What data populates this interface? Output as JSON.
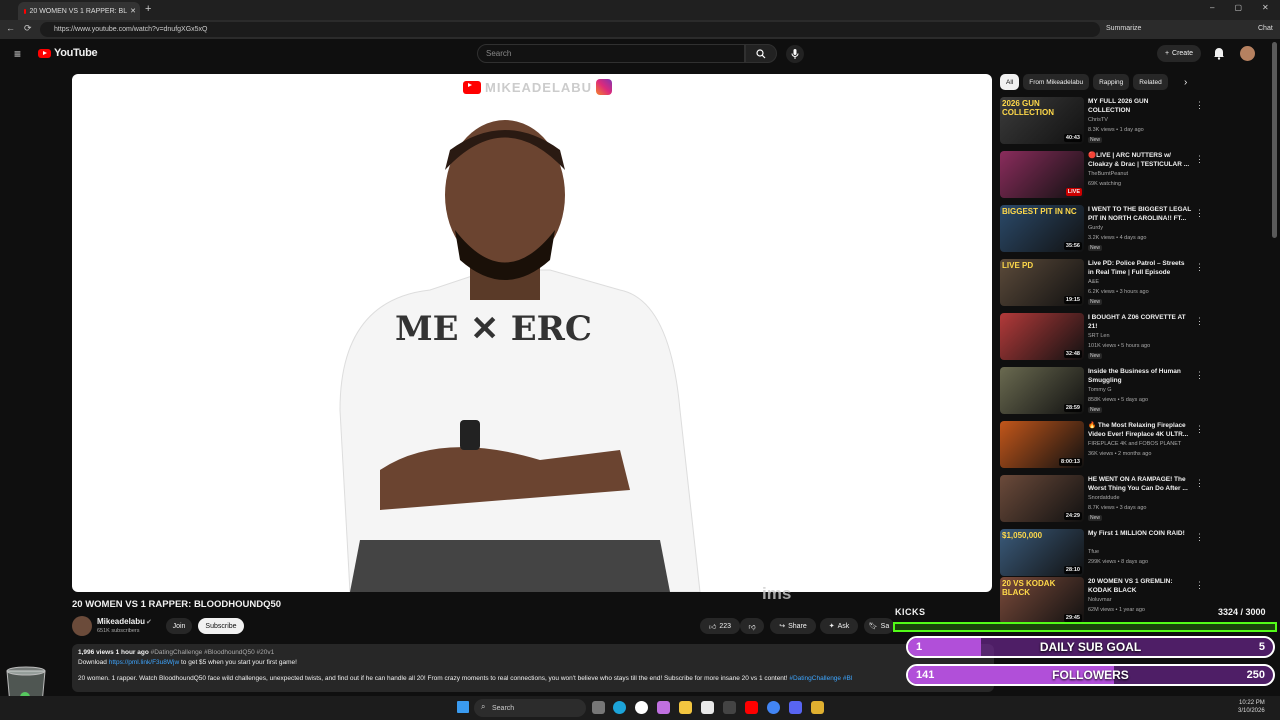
{
  "browser": {
    "tab_title": "20 WOMEN VS 1 RAPPER: BL",
    "url": "https://www.youtube.com/watch?v=dnufgXGx5xQ",
    "summarize_label": "Summarize",
    "chat_label": "Chat"
  },
  "header": {
    "logo_text": "YouTube",
    "search_placeholder": "Search",
    "create_label": "Create"
  },
  "video": {
    "channel_watermark": "MIKEADELABU",
    "caption_text": "ims",
    "title": "20 WOMEN VS 1 RAPPER: BLOODHOUNDQ50",
    "channel_name": "Mikeadelabu",
    "channel_subs": "651K subscribers",
    "join_label": "Join",
    "subscribe_label": "Subscribe",
    "like_count": "223",
    "share_label": "Share",
    "ask_label": "Ask",
    "save_label": "Sa"
  },
  "description": {
    "meta": "1,996 views  1 hour ago",
    "hashtags": "#DatingChallenge #BloodhoundQ50 #20v1",
    "download_prefix": "Download",
    "download_link": "https://pml.link/F3u8Wjw",
    "download_suffix": "to get $5 when you start your first game!",
    "body": "20 women. 1 rapper. Watch BloodhoundQ50 face wild challenges, unexpected twists, and find out if he can handle all 20! From crazy moments to real connections, you won't believe who stays till the end! Subscribe for more insane 20 vs 1 content!",
    "body_tags": "#DatingChallenge #Bl"
  },
  "chips": [
    "All",
    "From Mikeadelabu",
    "Rapping",
    "Related"
  ],
  "recommendations": [
    {
      "title": "MY FULL 2026 GUN COLLECTION",
      "channel": "ChrisTV",
      "meta": "8.3K views • 1 day ago",
      "badge": "New",
      "duration": "40:43",
      "thumb_text": "2026 GUN COLLECTION",
      "color": "#3b3b3b"
    },
    {
      "title": "🔴LIVE | ARC NUTTERS w/ Cloakzy & Drac | TESTICULAR ...",
      "channel": "TheBurntPeanut",
      "meta": "69K watching",
      "badge": "",
      "duration": "LIVE",
      "thumb_text": "",
      "color": "#8a2c5c"
    },
    {
      "title": "I WENT TO THE BIGGEST LEGAL PIT IN NORTH CAROLINA!! FT...",
      "channel": "Gurdy",
      "meta": "3.2K views • 4 days ago",
      "badge": "New",
      "duration": "35:56",
      "thumb_text": "BIGGEST PIT IN NC",
      "color": "#2b4a6a"
    },
    {
      "title": "Live PD: Police Patrol – Streets in Real Time | Full Episode",
      "channel": "A&E",
      "meta": "6.2K views • 3 hours ago",
      "badge": "New",
      "duration": "19:15",
      "thumb_text": "LIVE PD",
      "color": "#5b4a3a"
    },
    {
      "title": "I BOUGHT A Z06 CORVETTE AT 21!",
      "channel": "SRT Len",
      "meta": "101K views • 5 hours ago",
      "badge": "New",
      "duration": "32:48",
      "thumb_text": "",
      "color": "#b33a3a"
    },
    {
      "title": "Inside the Business of Human Smuggling",
      "channel": "Tommy G",
      "meta": "858K views • 5 days ago",
      "badge": "New",
      "duration": "28:59",
      "thumb_text": "",
      "color": "#6a6a50"
    },
    {
      "title": "🔥 The Most Relaxing Fireplace Video Ever! Fireplace 4K ULTR...",
      "channel": "FIREPLACE 4K and FOBOS PLANET",
      "meta": "36K views • 2 months ago",
      "badge": "",
      "duration": "8:00:13",
      "thumb_text": "",
      "color": "#c2561a"
    },
    {
      "title": "HE WENT ON A RAMPAGE! The Worst Thing You Can Do After ...",
      "channel": "Snordatdude",
      "meta": "8.7K views • 3 days ago",
      "badge": "New",
      "duration": "24:29",
      "thumb_text": "",
      "color": "#6b4a3a"
    },
    {
      "title": "My First 1 MILLION COIN RAID!",
      "channel": "Tfue",
      "meta": "299K views • 8 days ago",
      "badge": "",
      "duration": "28:10",
      "thumb_text": "$1,050,000",
      "color": "#3a5a7a"
    },
    {
      "title": "20 WOMEN VS 1 GREMLIN: KODAK BLACK",
      "channel": "Noluvmar",
      "meta": "62M views • 1 year ago",
      "badge": "",
      "duration": "29:45",
      "thumb_text": "20 VS KODAK BLACK",
      "color": "#7a4a3a"
    }
  ],
  "stream_overlay": {
    "kicks_label": "KICKS",
    "kicks_total": "3324  / 3000",
    "kicks_progress": 1.0,
    "sub_goal_current": "1",
    "sub_goal_label": "DAILY SUB GOAL",
    "sub_goal_target": "5",
    "sub_goal_progress": 0.2,
    "followers_current": "141",
    "followers_label": "FOLLOWERS",
    "followers_target": "250",
    "followers_progress": 0.564
  },
  "taskbar": {
    "search_label": "Search",
    "time": "10:22 PM",
    "date": "3/10/2026"
  }
}
